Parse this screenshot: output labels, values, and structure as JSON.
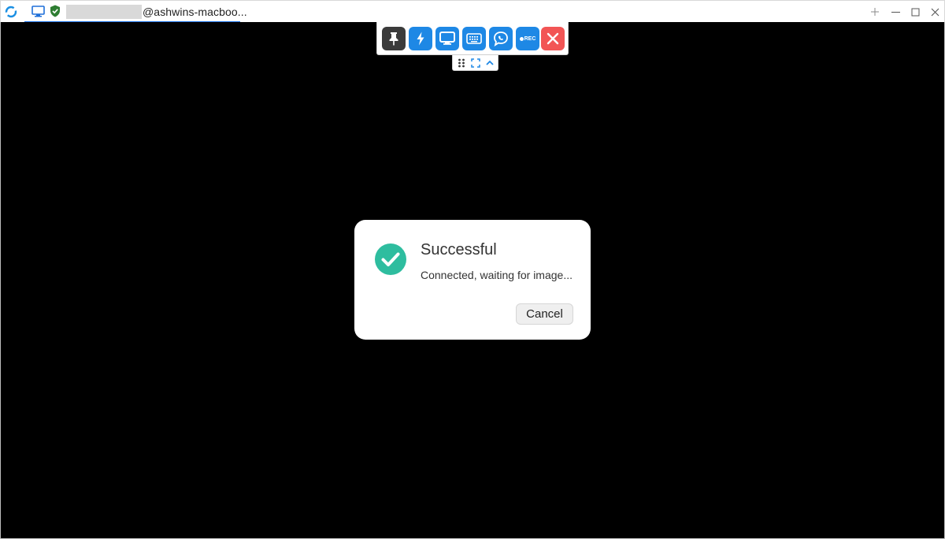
{
  "titlebar": {
    "tab": {
      "label": "@ashwins-macboo..."
    },
    "window_controls": [
      "new-tab",
      "minimize",
      "maximize",
      "close"
    ]
  },
  "toolbar": {
    "buttons": [
      {
        "name": "pin",
        "icon": "pin-icon",
        "color": "#3b3b3b"
      },
      {
        "name": "actions",
        "icon": "lightning-icon",
        "color": "#1e88e5"
      },
      {
        "name": "display",
        "icon": "monitor-icon",
        "color": "#1e88e5"
      },
      {
        "name": "keyboard",
        "icon": "keyboard-icon",
        "color": "#1e88e5"
      },
      {
        "name": "chat",
        "icon": "chat-icon",
        "color": "#1e88e5"
      },
      {
        "name": "record",
        "icon": "record-icon",
        "label": "REC",
        "color": "#1e88e5"
      },
      {
        "name": "close",
        "icon": "close-icon",
        "color": "#f25555"
      }
    ],
    "subbar": [
      "drag-handle-icon",
      "fullscreen-icon",
      "collapse-icon"
    ]
  },
  "dialog": {
    "title": "Successful",
    "message": "Connected, waiting for image...",
    "cancel_label": "Cancel",
    "status_color": "#2ebd9f"
  }
}
